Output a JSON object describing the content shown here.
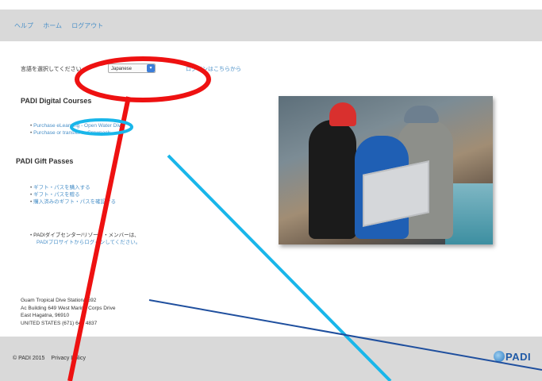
{
  "topnav": {
    "links": [
      "ヘルプ",
      "ホーム",
      "ログアウト"
    ]
  },
  "language": {
    "prompt": "言語を選択してください",
    "selected": "Japanese",
    "other_link": "ログインはこちらから"
  },
  "digital_courses": {
    "title": "PADI Digital Courses",
    "items": [
      "Purchase eLearning - Open Water Diver",
      "Purchase or transfer to Crewpack"
    ]
  },
  "gift_passes": {
    "title": "PADI Gift Passes",
    "items": [
      "ギフト・パスを購入する",
      "ギフト・パスを贈る",
      "購入済みのギフト・パスを確認する"
    ]
  },
  "dive_center": {
    "line1": "PADIダイブセンター/リゾート・メンバーは、",
    "line2": "PADIプロサイトからログインしてください。"
  },
  "address": {
    "lines": [
      "Guam Tropical Dive Station/2592",
      "Ac Building 649 West Marine Corps Drive",
      "East Hagatna, 96910",
      "UNITED STATES (671) 648 4837"
    ]
  },
  "footer": {
    "copyright": "© PADI 2015",
    "privacy": "Privacy Policy",
    "logo_text": "PADI"
  },
  "annotations": {
    "red_color": "#ee1111",
    "blue_color": "#19b6ea",
    "navy_color": "#1f4f9e"
  }
}
